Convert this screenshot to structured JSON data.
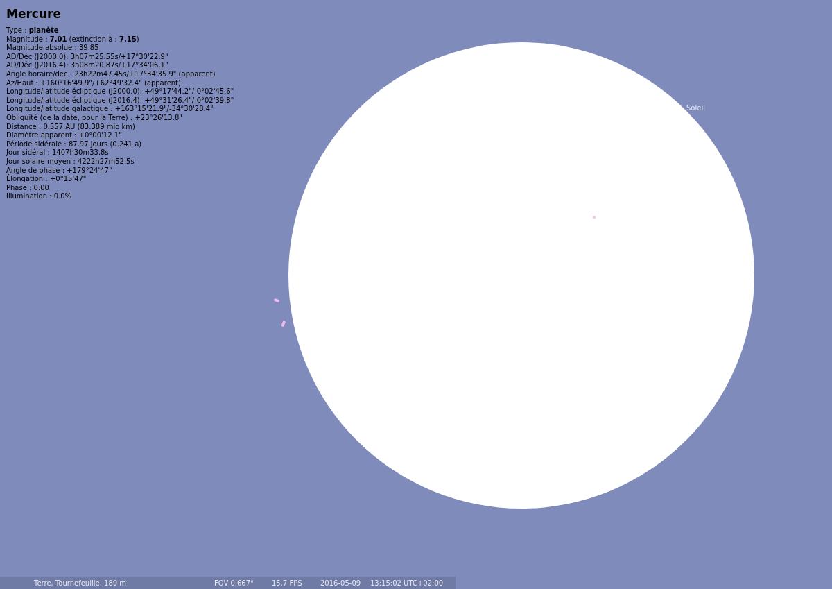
{
  "object_info": {
    "title": "Mercure",
    "lines": [
      "Type : **planète**",
      "Magnitude : **7.01** (extinction à : **7.15**)",
      "Magnitude absolue : 39.85",
      "AD/Déc (J2000.0): 3h07m25.55s/+17°30'22.9\"",
      "AD/Déc (J2016.4): 3h08m20.87s/+17°34'06.1\"",
      "Angle horaire/dec : 23h22m47.45s/+17°34'35.9\" (apparent)",
      "Az/Haut : +160°16'49.9\"/+62°49'32.4\" (apparent)",
      "Longitude/latitude écliptique (J2000.0): +49°17'44.2\"/-0°02'45.6\"",
      "Longitude/latitude écliptique (J2016.4): +49°31'26.4\"/-0°02'39.8\"",
      "Longitude/latitude galactique : +163°15'21.9\"/-34°30'28.4\"",
      "Obliquité (de la date, pour la Terre) : +23°26'13.8\"",
      "Distance : 0.557 AU (83.389 mio km)",
      "Diamètre apparent : +0°00'12.1\"",
      "Période sidérale : 87.97 jours (0.241 a)",
      "Jour sidéral : 1407h30m33.8s",
      "Jour solaire moyen : 4222h27m52.5s",
      "Angle de phase : +179°24'47\"",
      "Élongation : +0°15'47\"",
      "Phase : 0.00",
      "Illumination : 0.0%"
    ]
  },
  "sky": {
    "sun_label": "Soleil"
  },
  "status_bar": {
    "location": "Terre, Tournefeuille, 189 m",
    "fov": "FOV 0.667°",
    "fps": "15.7 FPS",
    "date": "2016-05-09",
    "time": "13:15:02 UTC+02:00"
  }
}
